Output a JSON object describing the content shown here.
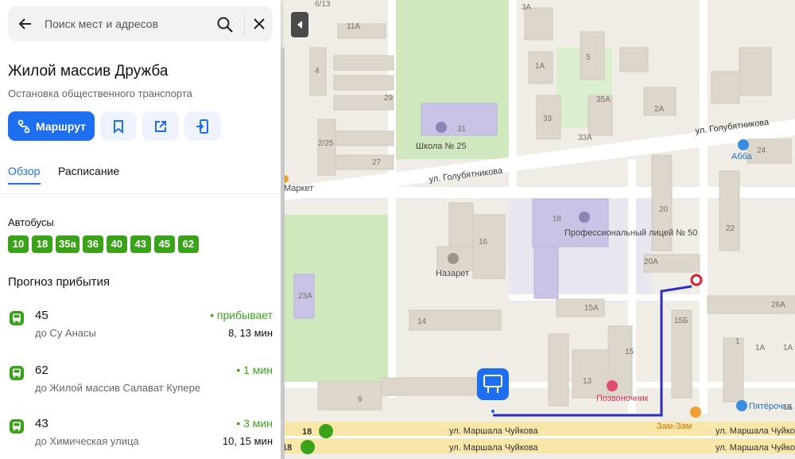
{
  "search": {
    "placeholder": "Поиск мест и адресов"
  },
  "place": {
    "title": "Жилой массив Дружба",
    "subtitle": "Остановка общественного транспорта"
  },
  "actions": {
    "route_label": "Маршрут"
  },
  "tabs": [
    {
      "label": "Обзор",
      "active": true
    },
    {
      "label": "Расписание",
      "active": false
    }
  ],
  "buses": {
    "title": "Автобусы",
    "routes": [
      "10",
      "18",
      "35а",
      "36",
      "40",
      "43",
      "45",
      "62"
    ]
  },
  "arrivals": {
    "title": "Прогноз прибытия",
    "items": [
      {
        "route": "45",
        "destination": "до Су Анасы",
        "status": "• прибывает",
        "times": "8, 13 мин"
      },
      {
        "route": "62",
        "destination": "до Жилой массив Салават Купере",
        "status": "• 1 мин",
        "times": ""
      },
      {
        "route": "43",
        "destination": "до Химическая улица",
        "status": "• 3 мин",
        "times": "10, 15 мин"
      }
    ]
  },
  "map": {
    "streets": [
      "ул. Голубятникова",
      "ул. Голубятникова",
      "ул. Маршала Чуйкова",
      "ул. Маршала Чуйкова",
      "ул. Маршала Чуйкова",
      "ул. Маршала Чуйкова"
    ],
    "pois": [
      "Школа № 25",
      "Профессиональный лицей № 50",
      "Назарет",
      "Позвоночник",
      "Зам-Зам",
      "Пятёрочка",
      "Абба",
      "Маркет"
    ],
    "house_numbers": [
      "6/13",
      "11А",
      "3А",
      "4",
      "29",
      "1А",
      "5",
      "35А",
      "2А",
      "31",
      "33",
      "33А",
      "2/25",
      "27",
      "24",
      "18",
      "20",
      "22",
      "16",
      "20А",
      "23А",
      "14",
      "15А",
      "26А",
      "15Б",
      "15",
      "13",
      "9",
      "1",
      "1А",
      "1Б",
      "1А"
    ],
    "stop_route_badges": [
      "18",
      "18"
    ],
    "colors": {
      "route_line": "#2a2fbf",
      "stop_marker": "#1e6ef0",
      "park": "#cfe8bd",
      "road": "#ffffff",
      "major_road": "#f8e7a8",
      "building": "#dcd6cc"
    }
  }
}
